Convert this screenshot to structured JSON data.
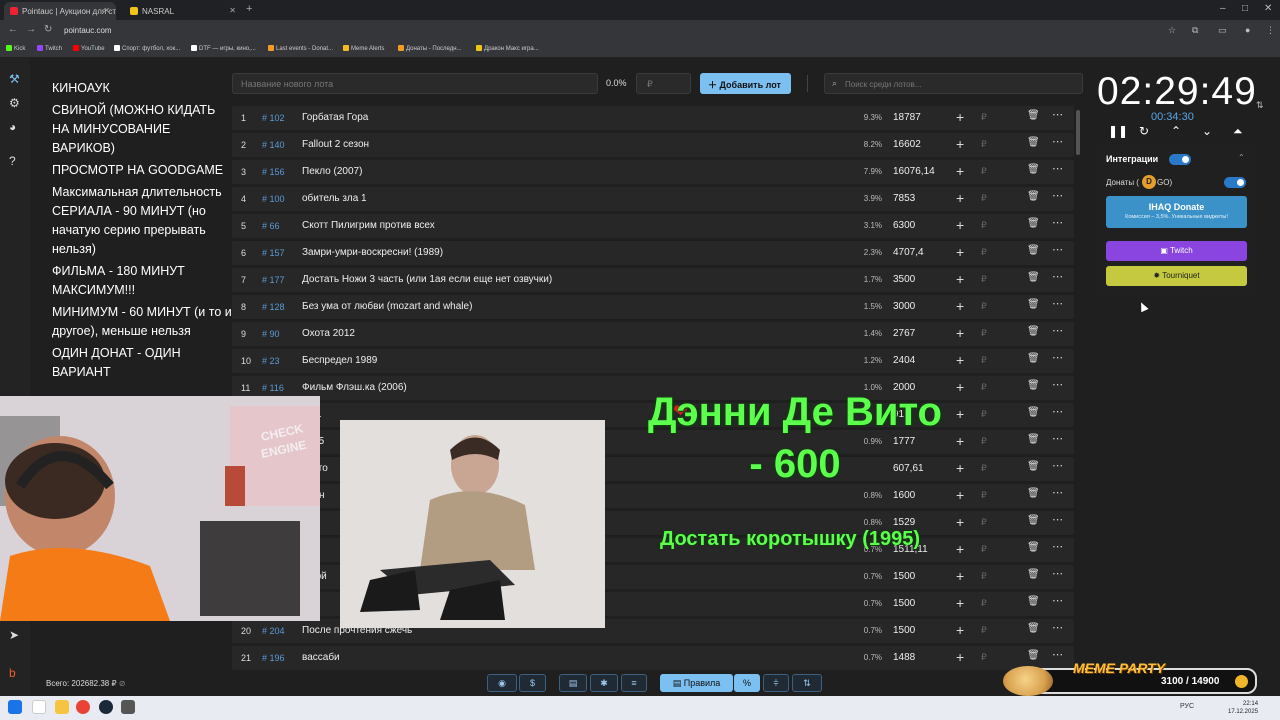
{
  "browser": {
    "tabs": [
      {
        "title": "Pointauc | Аукцион для стрим...",
        "active": true
      },
      {
        "title": "NASRAL",
        "active": false
      }
    ],
    "url": "pointauc.com",
    "bookmarks": [
      "Kick",
      "Twitch",
      "YouTube",
      "Спорт: футбол, хок...",
      "DTF — игры, кино,...",
      "Last events - Donat...",
      "Meme Alerts",
      "Донаты - Последн...",
      "Дракон Макс игра..."
    ]
  },
  "rules": [
    "КИНОАУК",
    "СВИНОЙ (МОЖНО КИДАТЬ НА МИНУСОВАНИЕ ВАРИКОВ)",
    "ПРОСМОТР НА GOODGAME",
    "Максимальная длительность СЕРИАЛА - 90 МИНУТ (но начатую серию прерывать нельзя)",
    "ФИЛЬМА - 180 МИНУТ МАКСИМУМ!!!",
    "МИНИМУМ - 60 МИНУТ (и то и другое), меньше нельзя",
    "ОДИН ДОНАТ - ОДИН ВАРИАНТ"
  ],
  "controls": {
    "lot_placeholder": "Название нового лота",
    "percent": "0.0%",
    "amount_placeholder": "₽",
    "add_label": "Добавить лот",
    "search_placeholder": "Поиск среди лотов..."
  },
  "lots": [
    {
      "idx": "1",
      "id": "# 102",
      "name": "Горбатая Гора",
      "pct": "9.3%",
      "amount": "18787"
    },
    {
      "idx": "2",
      "id": "# 140",
      "name": "Fallout 2 сезон",
      "pct": "8.2%",
      "amount": "16602"
    },
    {
      "idx": "3",
      "id": "# 156",
      "name": "Пекло (2007)",
      "pct": "7.9%",
      "amount": "16076,14"
    },
    {
      "idx": "4",
      "id": "# 100",
      "name": "обитель зла 1",
      "pct": "3.9%",
      "amount": "7853"
    },
    {
      "idx": "5",
      "id": "# 66",
      "name": "Скотт Пилигрим против всех",
      "pct": "3.1%",
      "amount": "6300"
    },
    {
      "idx": "6",
      "id": "# 157",
      "name": "Замри-умри-воскресни! (1989)",
      "pct": "2.3%",
      "amount": "4707,4"
    },
    {
      "idx": "7",
      "id": "# 177",
      "name": "Достать Ножи 3 часть (или 1ая если еще нет озвучки)",
      "pct": "1.7%",
      "amount": "3500"
    },
    {
      "idx": "8",
      "id": "# 128",
      "name": "Без ума от любви (mozart and whale)",
      "pct": "1.5%",
      "amount": "3000"
    },
    {
      "idx": "9",
      "id": "# 90",
      "name": "Охота 2012",
      "pct": "1.4%",
      "amount": "2767"
    },
    {
      "idx": "10",
      "id": "# 23",
      "name": "Беспредел 1989",
      "pct": "1.2%",
      "amount": "2404"
    },
    {
      "idx": "11",
      "id": "# 116",
      "name": "Фильм Флэш.ка (2006)",
      "pct": "1.0%",
      "amount": "2000"
    },
    {
      "idx": "",
      "id": "",
      "name": "rio 1",
      "pct": "",
      "amount": "91"
    },
    {
      "idx": "",
      "id": "",
      "name": "2025",
      "pct": "0.9%",
      "amount": "1777"
    },
    {
      "idx": "",
      "id": "",
      "name": "ым го",
      "pct": "",
      "amount": "607,61"
    },
    {
      "idx": "",
      "id": "",
      "name": "илён",
      "pct": "0.8%",
      "amount": "1600"
    },
    {
      "idx": "",
      "id": "",
      "name": "ICE",
      "pct": "0.8%",
      "amount": "1529"
    },
    {
      "idx": "",
      "id": "",
      "name": "ный",
      "pct": "0.7%",
      "amount": "1511,11"
    },
    {
      "idx": "",
      "id": "",
      "name": "ашой",
      "pct": "0.7%",
      "amount": "1500"
    },
    {
      "idx": "",
      "id": "",
      "name": "пом",
      "pct": "0.7%",
      "amount": "1500"
    },
    {
      "idx": "20",
      "id": "# 204",
      "name": "После прочтения сжечь",
      "pct": "0.7%",
      "amount": "1500"
    },
    {
      "idx": "21",
      "id": "# 196",
      "name": "вассаби",
      "pct": "0.7%",
      "amount": "1488"
    }
  ],
  "timer": {
    "main": "02:29:49",
    "sub": "00:34:30"
  },
  "integrations": {
    "title": "Интеграции",
    "donats_label": "Донаты (",
    "donats_suffix": "GO)",
    "donats_logo": "D",
    "ihaq_title": "IHAQ Donate",
    "ihaq_subtitle": "Комиссия – 3,5%. Уникальные виджеты!",
    "twitch": "Twitch",
    "tourniquet": "Tourniquet"
  },
  "total": "Всего: 202682.38 ₽",
  "bottom": {
    "rules_label": "Правила",
    "percent_icon": "%"
  },
  "alert": {
    "name": "Дэнни Де Вито - 600",
    "movie": "Достать коротышку (1995)"
  },
  "meme_party": {
    "title": "MEME PARTY",
    "count": "3100 / 14900"
  },
  "taskbar": {
    "lang": "РУС",
    "time": "22:14",
    "date": "17.12.2025"
  },
  "colors": {
    "accent": "#7cc0f2",
    "twitch": "#8a45e0",
    "tourniquet": "#c4c93f",
    "alert_green": "#5cff4c"
  }
}
